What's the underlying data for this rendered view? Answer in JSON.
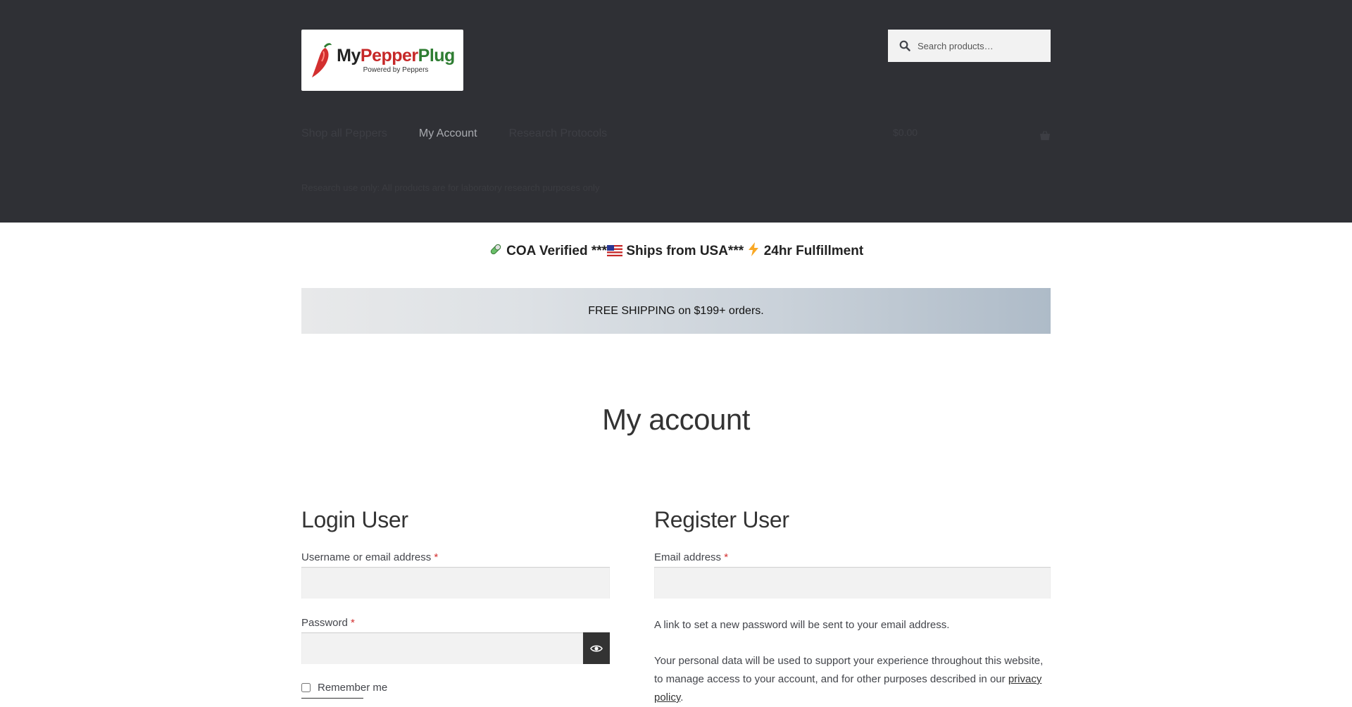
{
  "header": {
    "logo": {
      "title_my": "My",
      "title_pepper": "Pepper",
      "title_plug": "Plug",
      "subtitle": "Powered by Peppers"
    },
    "search": {
      "placeholder": "Search products…"
    },
    "nav": {
      "items": [
        {
          "label": "Shop all Peppers",
          "state": "dim"
        },
        {
          "label": "My Account",
          "state": "active"
        },
        {
          "label": "Research Protocols",
          "state": "dim"
        }
      ]
    },
    "cart": {
      "amount": "$0.00",
      "icon": "basket-icon"
    },
    "subnav": {
      "text": "Research use only: All products are for laboratory research purposes only"
    }
  },
  "trust_bar": {
    "part1": "COA Verified ***",
    "part2": "Ships from USA***",
    "part3": "24hr Fulfillment",
    "icons": [
      "pill-icon",
      "us-flag-icon",
      "lightning-icon"
    ]
  },
  "banner": {
    "text": "FREE SHIPPING on $199+ orders."
  },
  "page": {
    "title": "My account"
  },
  "login": {
    "heading": "Login User",
    "username_label": "Username or email address",
    "password_label": "Password",
    "required_mark": "*",
    "remember_label": "Remember me"
  },
  "register": {
    "heading": "Register User",
    "email_label": "Email address",
    "required_mark": "*",
    "password_note": "A link to set a new password will be sent to your email address.",
    "privacy_text": "Your personal data will be used to support your experience throughout this website, to manage access to your account, and for other purposes described in our",
    "privacy_link": "privacy policy",
    "privacy_end": "."
  },
  "colors": {
    "header_bg": "#2f3035",
    "accent": "#333333",
    "required": "#d32f2f"
  }
}
